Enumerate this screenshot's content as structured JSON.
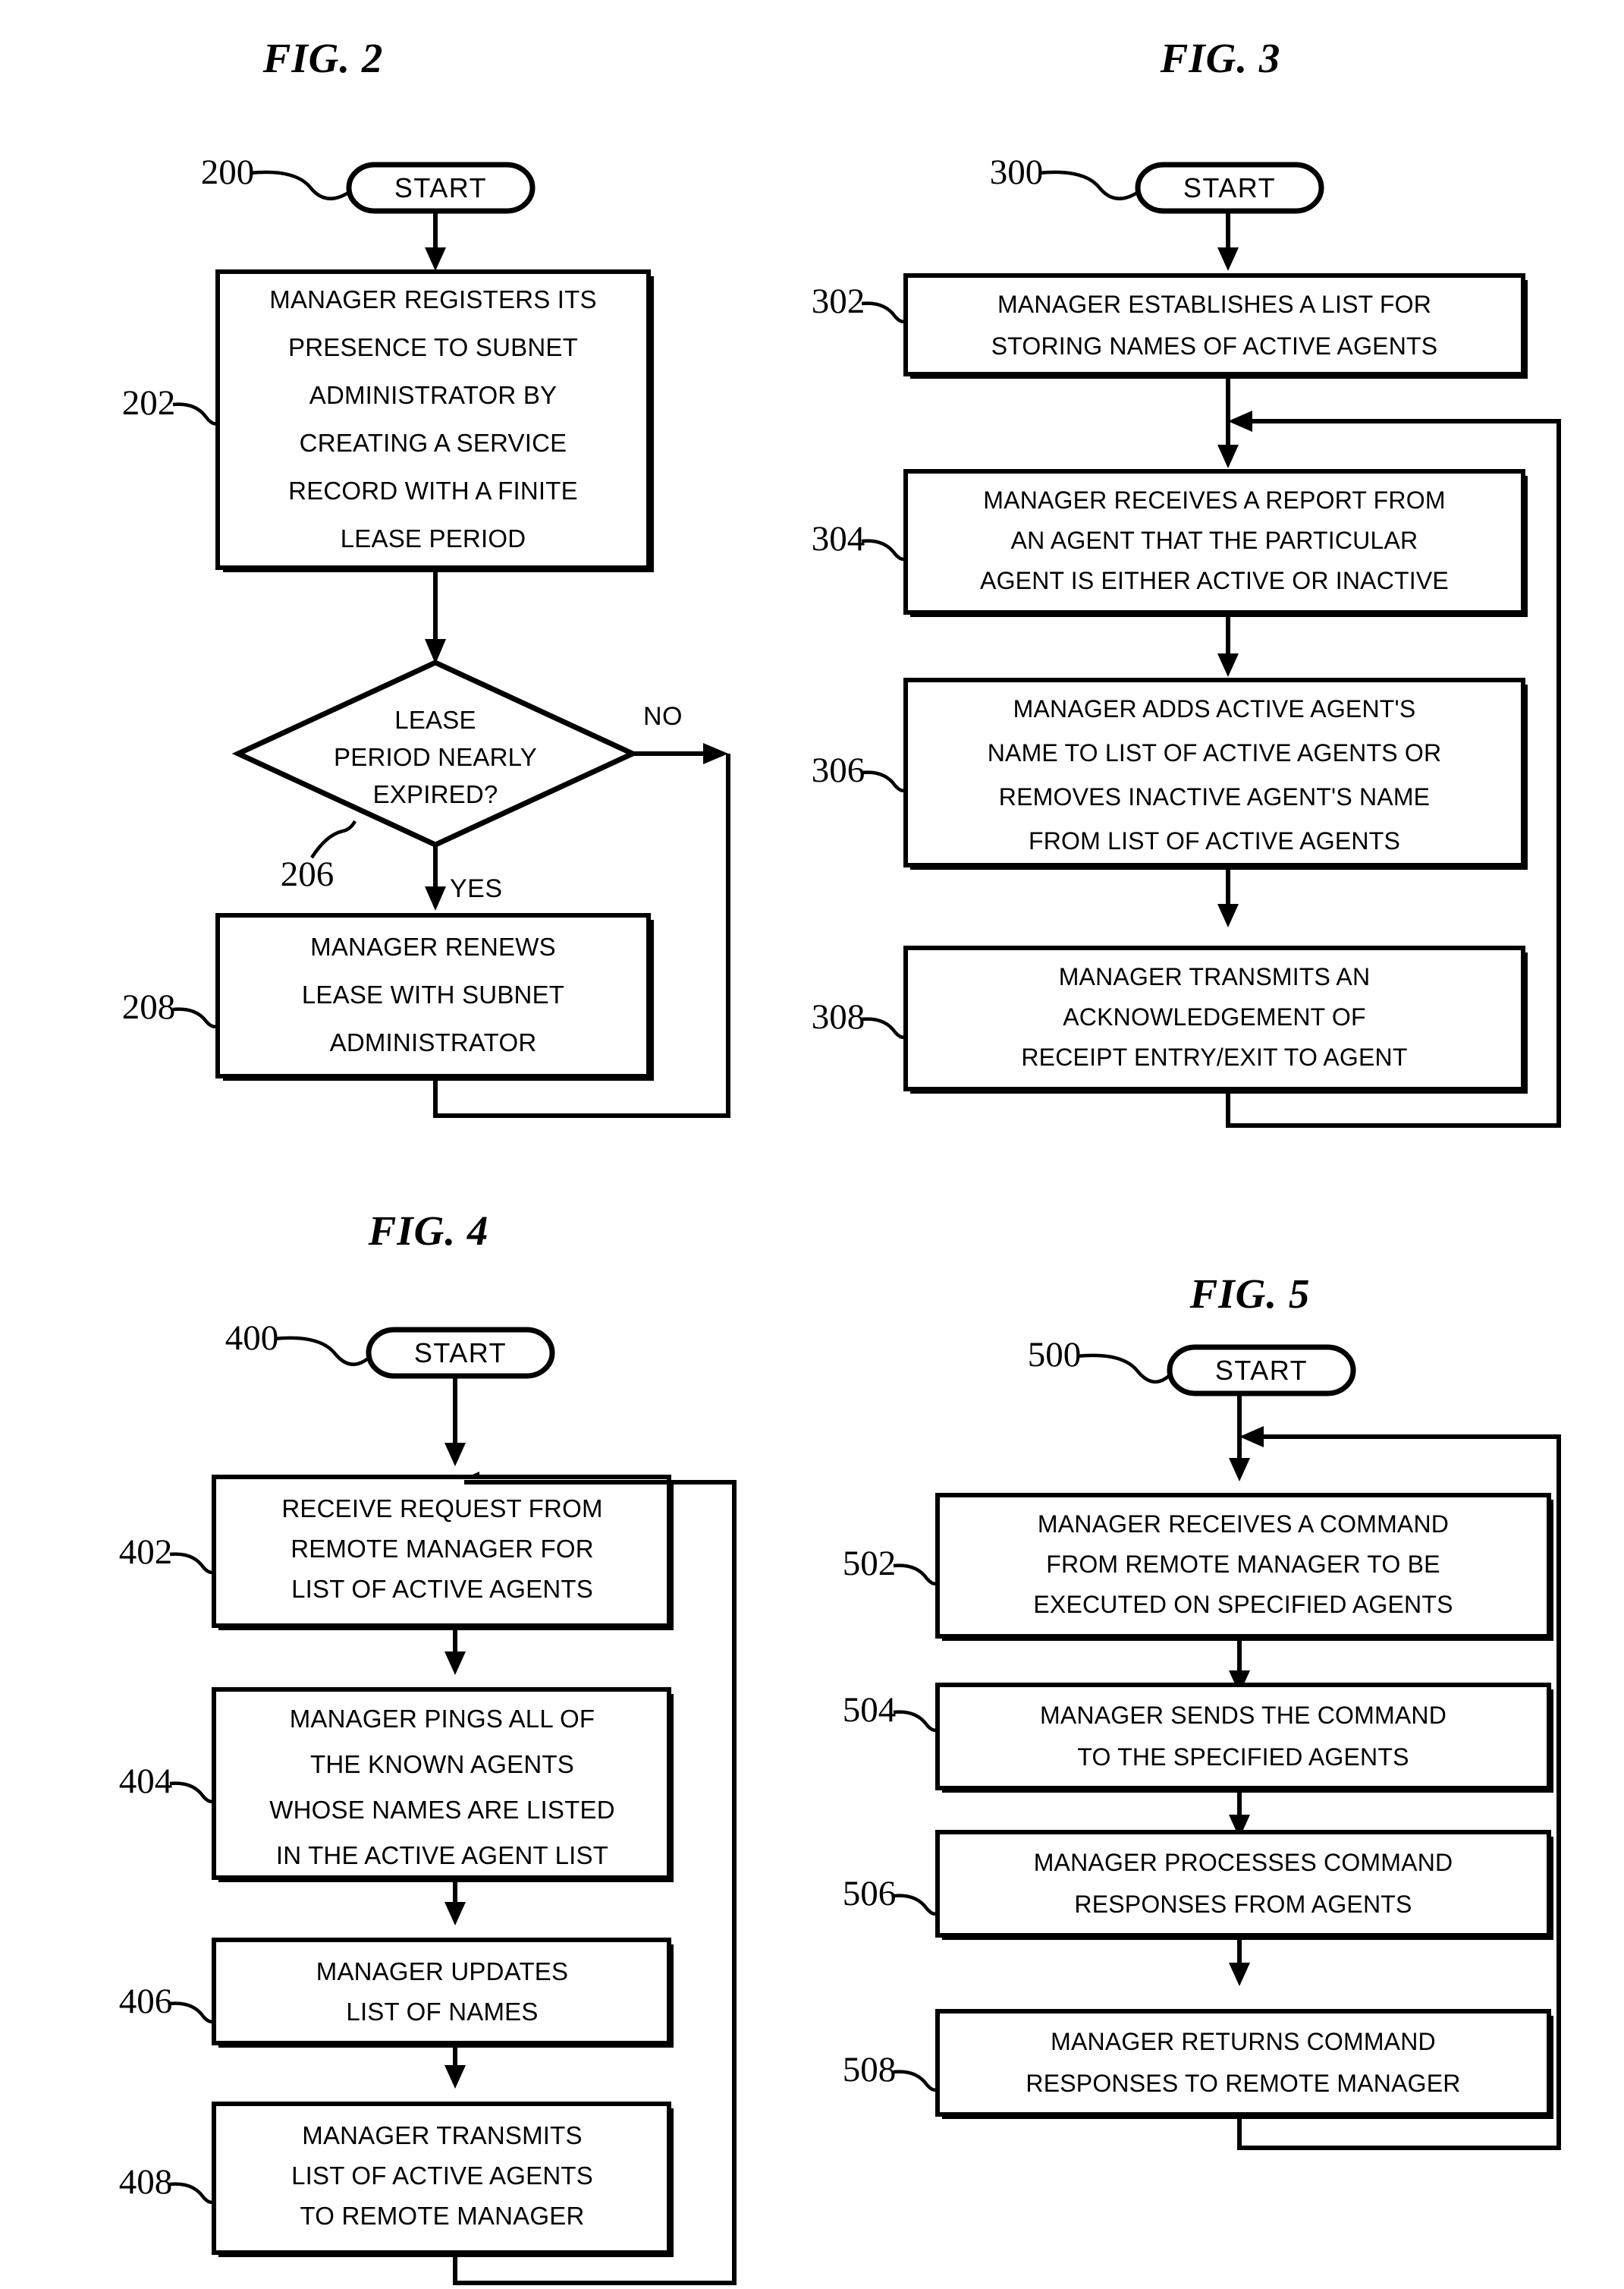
{
  "document": {
    "type": "patent-drawing-sheet",
    "figures": [
      {
        "id": "fig2",
        "title": "FIG. 2",
        "nodes": [
          {
            "ref": "200",
            "shape": "terminator",
            "lines": [
              "START"
            ]
          },
          {
            "ref": "202",
            "shape": "process",
            "lines": [
              "MANAGER REGISTERS ITS",
              "PRESENCE TO SUBNET",
              "ADMINISTRATOR BY",
              "CREATING A SERVICE",
              "RECORD WITH A FINITE",
              "LEASE PERIOD"
            ]
          },
          {
            "ref": "206",
            "shape": "decision",
            "lines": [
              "LEASE",
              "PERIOD NEARLY",
              "EXPIRED?"
            ],
            "branches": [
              "NO",
              "YES"
            ]
          },
          {
            "ref": "208",
            "shape": "process",
            "lines": [
              "MANAGER RENEWS",
              "LEASE WITH SUBNET",
              "ADMINISTRATOR"
            ]
          }
        ]
      },
      {
        "id": "fig3",
        "title": "FIG. 3",
        "nodes": [
          {
            "ref": "300",
            "shape": "terminator",
            "lines": [
              "START"
            ]
          },
          {
            "ref": "302",
            "shape": "process",
            "lines": [
              "MANAGER ESTABLISHES A LIST FOR",
              "STORING NAMES OF ACTIVE AGENTS"
            ]
          },
          {
            "ref": "304",
            "shape": "process",
            "lines": [
              "MANAGER RECEIVES A REPORT FROM",
              "AN AGENT THAT THE PARTICULAR",
              "AGENT IS EITHER ACTIVE OR INACTIVE"
            ]
          },
          {
            "ref": "306",
            "shape": "process",
            "lines": [
              "MANAGER ADDS ACTIVE AGENT'S",
              "NAME TO LIST OF ACTIVE AGENTS OR",
              "REMOVES INACTIVE AGENT'S NAME",
              "FROM LIST OF ACTIVE AGENTS"
            ]
          },
          {
            "ref": "308",
            "shape": "process",
            "lines": [
              "MANAGER TRANSMITS AN",
              "ACKNOWLEDGEMENT OF",
              "RECEIPT ENTRY/EXIT TO AGENT"
            ]
          }
        ]
      },
      {
        "id": "fig4",
        "title": "FIG. 4",
        "nodes": [
          {
            "ref": "400",
            "shape": "terminator",
            "lines": [
              "START"
            ]
          },
          {
            "ref": "402",
            "shape": "process",
            "lines": [
              "RECEIVE REQUEST FROM",
              "REMOTE MANAGER FOR",
              "LIST OF ACTIVE AGENTS"
            ]
          },
          {
            "ref": "404",
            "shape": "process",
            "lines": [
              "MANAGER PINGS ALL OF",
              "THE KNOWN AGENTS",
              "WHOSE NAMES ARE LISTED",
              "IN THE ACTIVE AGENT LIST"
            ]
          },
          {
            "ref": "406",
            "shape": "process",
            "lines": [
              "MANAGER UPDATES",
              "LIST OF NAMES"
            ]
          },
          {
            "ref": "408",
            "shape": "process",
            "lines": [
              "MANAGER TRANSMITS",
              "LIST OF ACTIVE AGENTS",
              "TO REMOTE MANAGER"
            ]
          }
        ]
      },
      {
        "id": "fig5",
        "title": "FIG. 5",
        "nodes": [
          {
            "ref": "500",
            "shape": "terminator",
            "lines": [
              "START"
            ]
          },
          {
            "ref": "502",
            "shape": "process",
            "lines": [
              "MANAGER RECEIVES A COMMAND",
              "FROM REMOTE MANAGER TO BE",
              "EXECUTED ON SPECIFIED AGENTS"
            ]
          },
          {
            "ref": "504",
            "shape": "process",
            "lines": [
              "MANAGER SENDS THE COMMAND",
              "TO THE SPECIFIED AGENTS"
            ]
          },
          {
            "ref": "506",
            "shape": "process",
            "lines": [
              "MANAGER PROCESSES COMMAND",
              "RESPONSES FROM AGENTS"
            ]
          },
          {
            "ref": "508",
            "shape": "process",
            "lines": [
              "MANAGER RETURNS COMMAND",
              "RESPONSES TO REMOTE MANAGER"
            ]
          }
        ]
      }
    ]
  },
  "fig2": {
    "title": "FIG. 2",
    "ref200": "200",
    "ref202": "202",
    "ref206": "206",
    "ref208": "208",
    "start": "START",
    "b202_l1": "MANAGER REGISTERS ITS",
    "b202_l2": "PRESENCE TO SUBNET",
    "b202_l3": "ADMINISTRATOR BY",
    "b202_l4": "CREATING A SERVICE",
    "b202_l5": "RECORD WITH A FINITE",
    "b202_l6": "LEASE PERIOD",
    "d206_l1": "LEASE",
    "d206_l2": "PERIOD NEARLY",
    "d206_l3": "EXPIRED?",
    "label_no": "NO",
    "label_yes": "YES",
    "b208_l1": "MANAGER RENEWS",
    "b208_l2": "LEASE WITH SUBNET",
    "b208_l3": "ADMINISTRATOR"
  },
  "fig3": {
    "title": "FIG. 3",
    "ref300": "300",
    "ref302": "302",
    "ref304": "304",
    "ref306": "306",
    "ref308": "308",
    "start": "START",
    "b302_l1": "MANAGER ESTABLISHES A LIST FOR",
    "b302_l2": "STORING NAMES OF ACTIVE AGENTS",
    "b304_l1": "MANAGER RECEIVES A REPORT FROM",
    "b304_l2": "AN AGENT THAT THE PARTICULAR",
    "b304_l3": "AGENT IS EITHER ACTIVE OR INACTIVE",
    "b306_l1": "MANAGER ADDS ACTIVE AGENT'S",
    "b306_l2": "NAME TO LIST OF ACTIVE AGENTS OR",
    "b306_l3": "REMOVES INACTIVE AGENT'S NAME",
    "b306_l4": "FROM LIST OF ACTIVE AGENTS",
    "b308_l1": "MANAGER TRANSMITS AN",
    "b308_l2": "ACKNOWLEDGEMENT OF",
    "b308_l3": "RECEIPT ENTRY/EXIT TO AGENT"
  },
  "fig4": {
    "title": "FIG. 4",
    "ref400": "400",
    "ref402": "402",
    "ref404": "404",
    "ref406": "406",
    "ref408": "408",
    "start": "START",
    "b402_l1": "RECEIVE REQUEST FROM",
    "b402_l2": "REMOTE MANAGER FOR",
    "b402_l3": "LIST OF ACTIVE AGENTS",
    "b404_l1": "MANAGER PINGS ALL OF",
    "b404_l2": "THE KNOWN AGENTS",
    "b404_l3": "WHOSE NAMES ARE LISTED",
    "b404_l4": "IN THE ACTIVE AGENT LIST",
    "b406_l1": "MANAGER UPDATES",
    "b406_l2": "LIST OF NAMES",
    "b408_l1": "MANAGER TRANSMITS",
    "b408_l2": "LIST OF ACTIVE AGENTS",
    "b408_l3": "TO REMOTE MANAGER"
  },
  "fig5": {
    "title": "FIG. 5",
    "ref500": "500",
    "ref502": "502",
    "ref504": "504",
    "ref506": "506",
    "ref508": "508",
    "start": "START",
    "b502_l1": "MANAGER RECEIVES A COMMAND",
    "b502_l2": "FROM REMOTE MANAGER TO BE",
    "b502_l3": "EXECUTED ON SPECIFIED AGENTS",
    "b504_l1": "MANAGER SENDS THE COMMAND",
    "b504_l2": "TO THE SPECIFIED AGENTS",
    "b506_l1": "MANAGER PROCESSES COMMAND",
    "b506_l2": "RESPONSES FROM AGENTS",
    "b508_l1": "MANAGER RETURNS COMMAND",
    "b508_l2": "RESPONSES TO REMOTE MANAGER"
  },
  "colors": {
    "ink": "#000000",
    "paper": "#ffffff"
  }
}
